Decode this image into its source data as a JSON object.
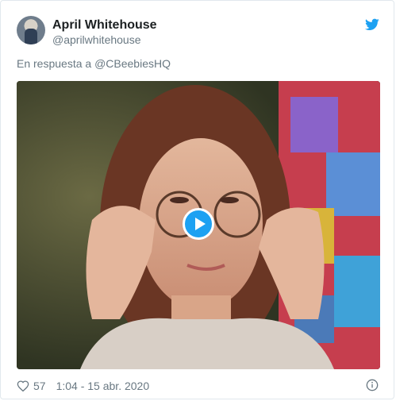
{
  "tweet": {
    "author_name": "April Whitehouse",
    "author_handle": "@aprilwhitehouse",
    "reply_prefix": "En respuesta a",
    "reply_mention": "@CBeebiesHQ",
    "likes": "57",
    "timestamp": "1:04 - 15 abr. 2020"
  },
  "icons": {
    "brand": "twitter-bird-icon",
    "like": "heart-icon",
    "info": "info-icon",
    "play": "play-icon"
  },
  "colors": {
    "accent": "#1da1f2",
    "muted_text": "#697882",
    "border": "#e1e8ed"
  }
}
